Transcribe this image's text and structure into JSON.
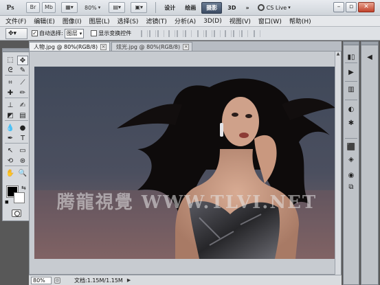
{
  "app": {
    "logo": "Ps",
    "title_buttons": [
      "Br",
      "Mb"
    ],
    "zoom_dropdown": "80%",
    "workspaces": [
      "设计",
      "绘画",
      "摄影",
      "3D"
    ],
    "active_workspace": "摄影",
    "more": "»",
    "cs_live": "CS Live",
    "window_controls": {
      "minimize": "–",
      "restore": "▫",
      "close": "✕"
    }
  },
  "menubar": {
    "items": [
      "文件(F)",
      "编辑(E)",
      "图像(I)",
      "图层(L)",
      "选择(S)",
      "滤镜(T)",
      "分析(A)",
      "3D(D)",
      "视图(V)",
      "窗口(W)",
      "帮助(H)"
    ]
  },
  "options": {
    "auto_select_label": "自动选择:",
    "auto_select_checked": true,
    "auto_select_target": "图层",
    "show_transform_label": "显示变换控件",
    "show_transform_checked": false
  },
  "tabs": [
    {
      "label": "人物.jpg @ 80%(RGB/8)",
      "active": true,
      "close": "×"
    },
    {
      "label": "炫光.jpg @ 80%(RGB/8)",
      "active": false,
      "close": "×"
    }
  ],
  "tools": {
    "icons": [
      "marquee-icon",
      "move-icon",
      "lasso-icon",
      "quick-select-icon",
      "crop-icon",
      "eyedropper-icon",
      "healing-icon",
      "brush-icon",
      "stamp-icon",
      "history-brush-icon",
      "eraser-icon",
      "gradient-icon",
      "blur-icon",
      "dodge-icon",
      "pen-icon",
      "type-icon",
      "path-select-icon",
      "shape-icon",
      "3d-rotate-icon",
      "3d-orbit-icon",
      "hand-icon",
      "zoom-icon"
    ],
    "glyphs": [
      "⬚",
      "✥",
      "ᘓ",
      "✎",
      "⌗",
      "⟋",
      "✚",
      "✏",
      "⊥",
      "✍",
      "◩",
      "▤",
      "💧",
      "●",
      "✒",
      "T",
      "↖",
      "▭",
      "⟲",
      "⊛",
      "✋",
      "🔍"
    ],
    "foreground_color": "#000000",
    "background_color": "#ffffff"
  },
  "document": {
    "image_description_colors": {
      "background_top": "#3f4859",
      "background_bottom": "#7d6567",
      "skin": "#c99a82",
      "hair": "#0e0b0b",
      "dress": "#2a2a2e"
    },
    "watermark": "腾龍視覺 WWW.TLVI.NET"
  },
  "status": {
    "zoom": "80%",
    "doc_info": "文档:1.15M/1.15M",
    "arrow": "▶"
  },
  "dock": {
    "col1_glyphs": [
      "▮▯",
      "▶",
      "▥",
      "◐",
      "✱",
      "⬛",
      "◈",
      "◉",
      "⧉"
    ],
    "col1_icons": [
      "histogram-icon",
      "actions-icon",
      "layers-comps-icon",
      "adjustments-icon",
      "brush-presets-icon",
      "swatches-icon",
      "layers-icon",
      "channels-icon",
      "paths-icon"
    ],
    "col2_glyphs": [
      "◀"
    ],
    "col2_icons": [
      "collapse-icon"
    ]
  }
}
